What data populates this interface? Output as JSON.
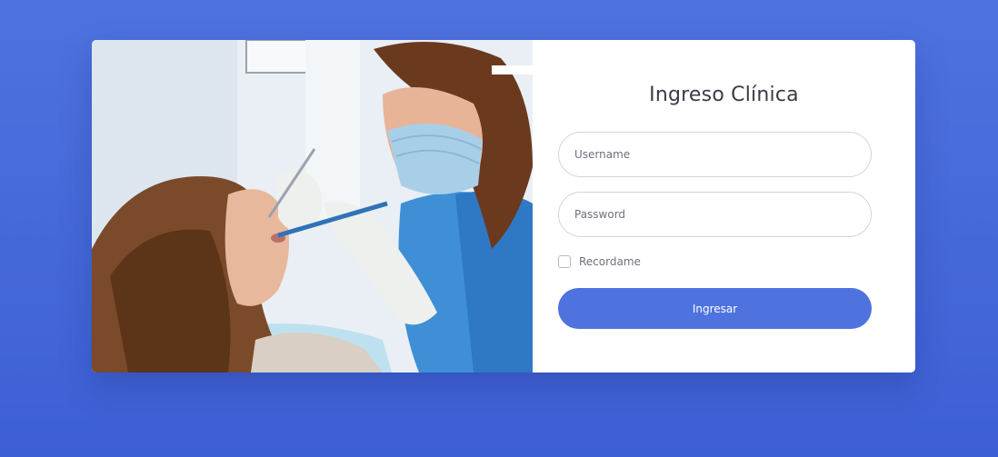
{
  "login": {
    "title": "Ingreso Clínica",
    "username": {
      "placeholder": "Username",
      "value": ""
    },
    "password": {
      "placeholder": "Password",
      "value": ""
    },
    "remember_label": "Recordame",
    "remember_checked": false,
    "submit_label": "Ingresar"
  },
  "theme": {
    "background": "#4e73df",
    "button": "#4e73df",
    "card": "#ffffff"
  },
  "photo": {
    "subject": "dentist-examining-patient-photo"
  }
}
